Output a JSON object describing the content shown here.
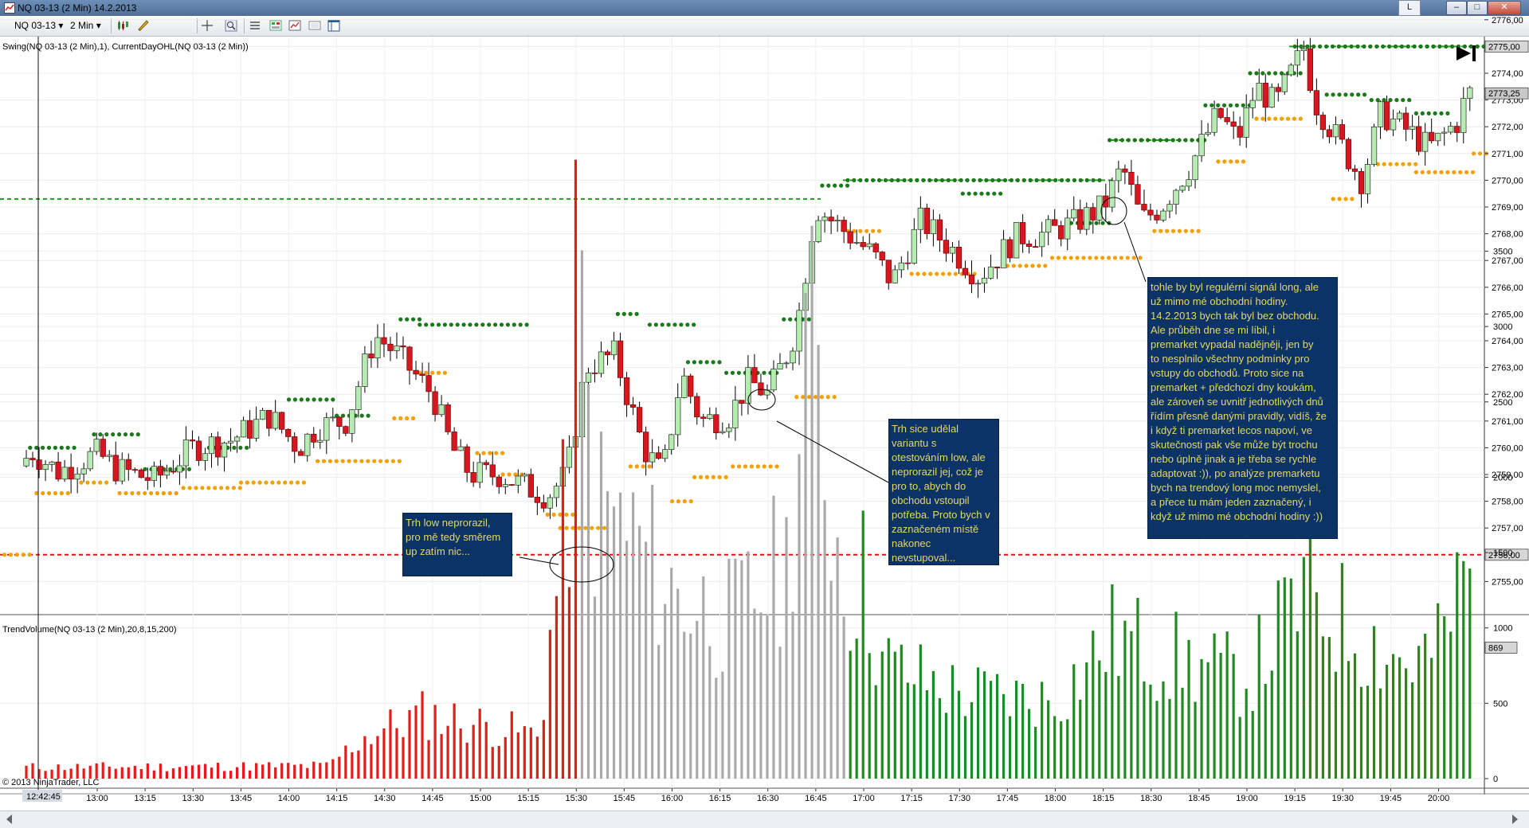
{
  "window": {
    "title": "NQ 03-13 (2 Min)  14.2.2013",
    "extra_button": "L",
    "minimize": "–",
    "maximize": "□",
    "close": "✕"
  },
  "toolbar": {
    "instrument": "NQ 03-13",
    "interval": "2 Min"
  },
  "icons": [
    "chart-window-icon",
    "chevron-down-icon",
    "bar-type-icon",
    "pen-icon",
    "crosshair-icon",
    "magnifier-icon",
    "properties-icon",
    "data-box-icon",
    "chart-trader-icon",
    "screenshot-icon",
    "layout-icon",
    "go-to-end-icon"
  ],
  "indicators": {
    "price_panel": "Swing(NQ 03-13 (2 Min),1), CurrentDayOHL(NQ 03-13 (2 Min))",
    "volume_panel": "TrendVolume(NQ 03-13 (2 Min),20,8,15,200)"
  },
  "copyright": "© 2013 NinjaTrader, LLC",
  "colors": {
    "up_candle": "#b6ecb1",
    "down_candle": "#d7161f",
    "swing_high": "#1a7a1a",
    "swing_low": "#f5a000",
    "current_high_line": "#1f9d1f",
    "current_low_line": "#e01010",
    "volume_red": "#e21b1b",
    "volume_gray": "#aaaaaa",
    "volume_green": "#1f8a1f",
    "note_bg": "#0b3366",
    "note_text": "#e6d76c"
  },
  "price_axis": {
    "ticks": [
      "2776,00",
      "2775,00",
      "2774,00",
      "2773,00",
      "2772,00",
      "2771,00",
      "2770,00",
      "2769,00",
      "2768,00",
      "2767,00",
      "2766,00",
      "2765,00",
      "2764,00",
      "2763,00",
      "2762,00",
      "2761,00",
      "2760,00",
      "2759,00",
      "2758,00",
      "2757,00",
      "2756,00",
      "2755,00"
    ],
    "high_label": "2775,00",
    "last_label": "2773,25",
    "low_label": "2756,00"
  },
  "volume_axis": {
    "ticks": [
      "3500",
      "3000",
      "2500",
      "2000",
      "1500",
      "1000",
      "500",
      "0"
    ],
    "last_label": "869"
  },
  "time_axis": {
    "ticks": [
      "13:00",
      "13:15",
      "13:30",
      "13:45",
      "14:00",
      "14:15",
      "14:30",
      "14:45",
      "15:00",
      "15:15",
      "15:30",
      "15:45",
      "16:00",
      "16:15",
      "16:30",
      "16:45",
      "17:00",
      "17:15",
      "17:30",
      "17:45",
      "18:00",
      "18:15",
      "18:30",
      "18:45",
      "19:00",
      "19:15",
      "19:30",
      "19:45",
      "20:00"
    ],
    "cursor_label": "12:42:45"
  },
  "notes": [
    {
      "id": "note-low-not-broken",
      "text": "Trh low neprorazil,\npro mě tedy směrem\nup zatím nic..."
    },
    {
      "id": "note-low-test",
      "text": "Trh sice udělal\nvariantu s\notestováním low, ale\nneprorazil jej, což je\npro to, abych do\nobchodu vstoupil\npotřeba. Proto bych v\nzaznačeném místě\nnakonec\nnevstupoval..."
    },
    {
      "id": "note-long-signal",
      "text": "tohle by byl regulérní signál long, ale\nuž mimo mé obchodní hodiny.\n14.2.2013 bych tak byl bez obchodu.\nAle průběh dne se mi líbil, i\npremarket vypadal nadějněji, jen by\nto nesplnilo všechny podmínky pro\nvstupy do obchodů. Proto sice na\npremarket + předchozí dny koukám,\nale zároveň se uvnitř jednotlivých dnů\nřídím přesně danými pravidly, vidíš, že\ni když ti premarket lecos napoví, ve\nskutečnosti pak vše může být trochu\nnebo úplně jinak a je třeba se rychle\nadaptovat :)), po analýze premarketu\nbych na trendový long moc nemyslel,\na přece tu mám jeden zaznačený, i\nkdyž už mimo mé obchodní hodiny :))"
    }
  ],
  "chart_data": {
    "type": "candlestick",
    "instrument": "NQ 03-13",
    "interval": "2 Min",
    "date": "14.2.2013",
    "ylim": [
      2754.7,
      2776.3
    ],
    "current_day": {
      "high": 2775.0,
      "low": 2756.0,
      "last": 2773.25
    },
    "previous_levels": [
      2769.3
    ],
    "close_anchors": [
      [
        12.6,
        2759.2
      ],
      [
        12.65,
        2759.9
      ],
      [
        12.8,
        2759.1
      ],
      [
        13.0,
        2759.8
      ],
      [
        13.1,
        2759.2
      ],
      [
        13.3,
        2758.8
      ],
      [
        13.5,
        2760.0
      ],
      [
        13.7,
        2760.3
      ],
      [
        13.9,
        2761.2
      ],
      [
        14.05,
        2760.0
      ],
      [
        14.15,
        2760.8
      ],
      [
        14.3,
        2761.0
      ],
      [
        14.45,
        2764.2
      ],
      [
        14.55,
        2763.6
      ],
      [
        14.75,
        2762.0
      ],
      [
        14.85,
        2760.0
      ],
      [
        14.95,
        2759.0
      ],
      [
        15.1,
        2759.0
      ],
      [
        15.25,
        2758.5
      ],
      [
        15.35,
        2758.2
      ],
      [
        15.45,
        2759.0
      ],
      [
        15.55,
        2763.0
      ],
      [
        15.7,
        2763.5
      ],
      [
        15.85,
        2760.0
      ],
      [
        15.95,
        2759.0
      ],
      [
        16.05,
        2762.8
      ],
      [
        16.15,
        2761.0
      ],
      [
        16.3,
        2761.2
      ],
      [
        16.4,
        2762.5
      ],
      [
        16.5,
        2762.0
      ],
      [
        16.6,
        2763.5
      ],
      [
        16.65,
        2764.5
      ],
      [
        16.75,
        2769.0
      ],
      [
        16.95,
        2767.8
      ],
      [
        17.05,
        2767.2
      ],
      [
        17.15,
        2766.2
      ],
      [
        17.3,
        2768.5
      ],
      [
        17.45,
        2767.5
      ],
      [
        17.6,
        2766.4
      ],
      [
        17.8,
        2767.9
      ],
      [
        17.95,
        2768.0
      ],
      [
        18.1,
        2768.4
      ],
      [
        18.25,
        2769.0
      ],
      [
        18.35,
        2770.5
      ],
      [
        18.45,
        2768.5
      ],
      [
        18.55,
        2769.0
      ],
      [
        18.7,
        2770.5
      ],
      [
        18.85,
        2772.5
      ],
      [
        18.95,
        2771.5
      ],
      [
        19.05,
        2773.5
      ],
      [
        19.15,
        2772.8
      ],
      [
        19.3,
        2775.0
      ],
      [
        19.35,
        2773.0
      ],
      [
        19.5,
        2771.2
      ],
      [
        19.6,
        2770.0
      ],
      [
        19.7,
        2772.5
      ],
      [
        19.85,
        2771.8
      ],
      [
        19.95,
        2771.2
      ],
      [
        20.0,
        2771.5
      ],
      [
        20.1,
        2772.2
      ],
      [
        20.15,
        2773.25
      ]
    ],
    "swing_highs": [
      {
        "from": "12:39",
        "to": "12:53",
        "price": 2760.0
      },
      {
        "from": "12:59",
        "to": "13:13",
        "price": 2760.5
      },
      {
        "from": "13:15",
        "to": "13:29",
        "price": 2759.2
      },
      {
        "from": "13:35",
        "to": "13:47",
        "price": 2760.0
      },
      {
        "from": "14:00",
        "to": "14:15",
        "price": 2761.8
      },
      {
        "from": "14:15",
        "to": "14:25",
        "price": 2761.2
      },
      {
        "from": "14:35",
        "to": "14:41",
        "price": 2764.8
      },
      {
        "from": "14:41",
        "to": "15:15",
        "price": 2764.6
      },
      {
        "from": "15:43",
        "to": "15:49",
        "price": 2765.0
      },
      {
        "from": "15:53",
        "to": "16:07",
        "price": 2764.6
      },
      {
        "from": "16:05",
        "to": "16:15",
        "price": 2763.2
      },
      {
        "from": "16:17",
        "to": "16:33",
        "price": 2762.8
      },
      {
        "from": "16:35",
        "to": "16:43",
        "price": 2764.8
      },
      {
        "from": "16:47",
        "to": "16:55",
        "price": 2769.8
      },
      {
        "from": "16:55",
        "to": "18:15",
        "price": 2770.0
      },
      {
        "from": "17:31",
        "to": "17:43",
        "price": 2769.5
      },
      {
        "from": "18:05",
        "to": "18:17",
        "price": 2768.4
      },
      {
        "from": "18:17",
        "to": "18:27",
        "price": 2771.5
      },
      {
        "from": "18:27",
        "to": "18:47",
        "price": 2771.5
      },
      {
        "from": "18:47",
        "to": "19:01",
        "price": 2772.8
      },
      {
        "from": "19:01",
        "to": "19:17",
        "price": 2774.0
      },
      {
        "from": "19:15",
        "to": "20:15",
        "price": 2775.0
      },
      {
        "from": "19:25",
        "to": "19:37",
        "price": 2773.2
      },
      {
        "from": "19:39",
        "to": "19:51",
        "price": 2773.0
      },
      {
        "from": "19:53",
        "to": "20:03",
        "price": 2772.5
      }
    ],
    "swing_lows": [
      {
        "from": "12:29",
        "to": "12:39",
        "price": 2756.0
      },
      {
        "from": "12:41",
        "to": "12:51",
        "price": 2758.3
      },
      {
        "from": "12:55",
        "to": "13:03",
        "price": 2758.7
      },
      {
        "from": "13:07",
        "to": "13:25",
        "price": 2758.3
      },
      {
        "from": "13:27",
        "to": "13:45",
        "price": 2758.5
      },
      {
        "from": "13:45",
        "to": "14:05",
        "price": 2758.7
      },
      {
        "from": "14:09",
        "to": "14:35",
        "price": 2759.5
      },
      {
        "from": "14:33",
        "to": "14:39",
        "price": 2761.1
      },
      {
        "from": "14:41",
        "to": "14:49",
        "price": 2762.8
      },
      {
        "from": "14:59",
        "to": "15:07",
        "price": 2759.8
      },
      {
        "from": "15:07",
        "to": "15:13",
        "price": 2759.0
      },
      {
        "from": "15:21",
        "to": "15:29",
        "price": 2757.5
      },
      {
        "from": "15:25",
        "to": "15:39",
        "price": 2757.0
      },
      {
        "from": "15:47",
        "to": "15:53",
        "price": 2759.3
      },
      {
        "from": "16:00",
        "to": "16:07",
        "price": 2758.0
      },
      {
        "from": "16:07",
        "to": "16:17",
        "price": 2758.9
      },
      {
        "from": "16:19",
        "to": "16:33",
        "price": 2759.3
      },
      {
        "from": "16:39",
        "to": "16:51",
        "price": 2761.9
      },
      {
        "from": "16:55",
        "to": "17:05",
        "price": 2768.1
      },
      {
        "from": "17:15",
        "to": "17:35",
        "price": 2766.5
      },
      {
        "from": "17:45",
        "to": "17:57",
        "price": 2766.8
      },
      {
        "from": "17:59",
        "to": "18:27",
        "price": 2767.1
      },
      {
        "from": "18:31",
        "to": "18:45",
        "price": 2768.1
      },
      {
        "from": "18:51",
        "to": "18:59",
        "price": 2770.7
      },
      {
        "from": "19:03",
        "to": "19:17",
        "price": 2772.3
      },
      {
        "from": "19:27",
        "to": "19:33",
        "price": 2769.3
      },
      {
        "from": "19:41",
        "to": "19:53",
        "price": 2770.6
      },
      {
        "from": "19:53",
        "to": "20:11",
        "price": 2770.3
      },
      {
        "from": "20:11",
        "to": "20:15",
        "price": 2771.0
      }
    ],
    "volume": {
      "anchors": [
        [
          12.6,
          80
        ],
        [
          14.2,
          90
        ],
        [
          14.4,
          300
        ],
        [
          14.7,
          450
        ],
        [
          15.0,
          380
        ],
        [
          15.3,
          300
        ],
        [
          15.47,
          2100
        ],
        [
          15.5,
          3480
        ],
        [
          15.6,
          1900
        ],
        [
          15.8,
          1700
        ],
        [
          16.0,
          1300
        ],
        [
          16.3,
          1100
        ],
        [
          16.6,
          1500
        ],
        [
          16.7,
          3100
        ],
        [
          16.9,
          1350
        ],
        [
          17.0,
          1400
        ],
        [
          17.1,
          800
        ],
        [
          17.5,
          600
        ],
        [
          18.0,
          550
        ],
        [
          18.3,
          1000
        ],
        [
          18.7,
          800
        ],
        [
          19.0,
          700
        ],
        [
          19.3,
          1300
        ],
        [
          19.6,
          1000
        ],
        [
          19.85,
          800
        ],
        [
          20.0,
          900
        ],
        [
          20.15,
          1450
        ]
      ],
      "red_until": 15.52,
      "green_from": 16.93,
      "ylim": [
        0,
        3700
      ]
    }
  }
}
